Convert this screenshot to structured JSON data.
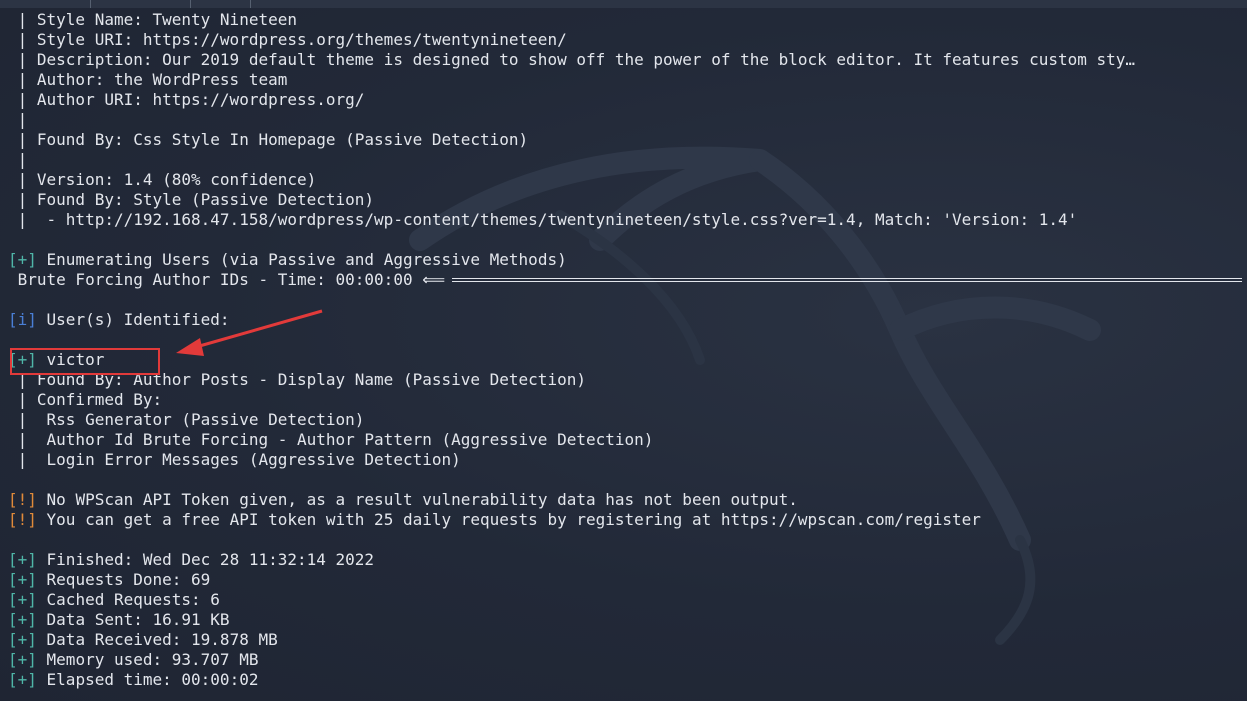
{
  "lines": [
    {
      "id": "style-name",
      "text": " | Style Name: Twenty Nineteen"
    },
    {
      "id": "style-uri",
      "text": " | Style URI: https://wordpress.org/themes/twentynineteen/"
    },
    {
      "id": "description",
      "text": " | Description: Our 2019 default theme is designed to show off the power of the block editor. It features custom sty…"
    },
    {
      "id": "author",
      "text": " | Author: the WordPress team"
    },
    {
      "id": "author-uri",
      "text": " | Author URI: https://wordpress.org/"
    },
    {
      "id": "blank-pipe-1",
      "text": " |"
    },
    {
      "id": "found-by-css",
      "text": " | Found By: Css Style In Homepage (Passive Detection)"
    },
    {
      "id": "blank-pipe-2",
      "text": " |"
    },
    {
      "id": "version",
      "text": " | Version: 1.4 (80% confidence)"
    },
    {
      "id": "found-by-style",
      "text": " | Found By: Style (Passive Detection)"
    },
    {
      "id": "style-match",
      "text": " |  - http://192.168.47.158/wordpress/wp-content/themes/twentynineteen/style.css?ver=1.4, Match: 'Version: 1.4'"
    },
    {
      "id": "blank-1",
      "text": ""
    },
    {
      "id": "enum-users",
      "tag": "[+]",
      "tagClass": "tag-plus",
      "text": " Enumerating Users (via Passive and Aggressive Methods)"
    },
    {
      "id": "brute-forcing",
      "text": " Brute Forcing Author IDs - Time: 00:00:00 ⟸"
    },
    {
      "id": "blank-2",
      "text": ""
    },
    {
      "id": "users-identified",
      "tag": "[i]",
      "tagClass": "tag-info",
      "text": " User(s) Identified:"
    },
    {
      "id": "blank-3",
      "text": ""
    },
    {
      "id": "user-victor",
      "tag": "[+]",
      "tagClass": "tag-plus",
      "text": " victor"
    },
    {
      "id": "victor-found-by",
      "text": " | Found By: Author Posts - Display Name (Passive Detection)"
    },
    {
      "id": "victor-confirmed",
      "text": " | Confirmed By:"
    },
    {
      "id": "victor-rss",
      "text": " |  Rss Generator (Passive Detection)"
    },
    {
      "id": "victor-author-id",
      "text": " |  Author Id Brute Forcing - Author Pattern (Aggressive Detection)"
    },
    {
      "id": "victor-login-error",
      "text": " |  Login Error Messages (Aggressive Detection)"
    },
    {
      "id": "blank-4",
      "text": ""
    },
    {
      "id": "no-token",
      "tag": "[!]",
      "tagClass": "tag-warn",
      "text": " No WPScan API Token given, as a result vulnerability data has not been output."
    },
    {
      "id": "free-token",
      "tag": "[!]",
      "tagClass": "tag-warn",
      "text": " You can get a free API token with 25 daily requests by registering at https://wpscan.com/register"
    },
    {
      "id": "blank-5",
      "text": ""
    },
    {
      "id": "finished",
      "tag": "[+]",
      "tagClass": "tag-plus",
      "text": " Finished: Wed Dec 28 11:32:14 2022"
    },
    {
      "id": "requests-done",
      "tag": "[+]",
      "tagClass": "tag-plus",
      "text": " Requests Done: 69"
    },
    {
      "id": "cached-requests",
      "tag": "[+]",
      "tagClass": "tag-plus",
      "text": " Cached Requests: 6"
    },
    {
      "id": "data-sent",
      "tag": "[+]",
      "tagClass": "tag-plus",
      "text": " Data Sent: 16.91 KB"
    },
    {
      "id": "data-received",
      "tag": "[+]",
      "tagClass": "tag-plus",
      "text": " Data Received: 19.878 MB"
    },
    {
      "id": "memory-used",
      "tag": "[+]",
      "tagClass": "tag-plus",
      "text": " Memory used: 93.707 MB"
    },
    {
      "id": "elapsed-time",
      "tag": "[+]",
      "tagClass": "tag-plus",
      "text": " Elapsed time: 00:00:02"
    }
  ],
  "colors": {
    "background": "#232a39",
    "text": "#e3e6ec",
    "tag_plus": "#4fb6a8",
    "tag_info": "#4a7fd6",
    "tag_warn": "#e08a3a",
    "highlight": "#e23a3a"
  },
  "annotation": {
    "highlighted_line": "user-victor",
    "shape": "red-box-with-arrow"
  }
}
